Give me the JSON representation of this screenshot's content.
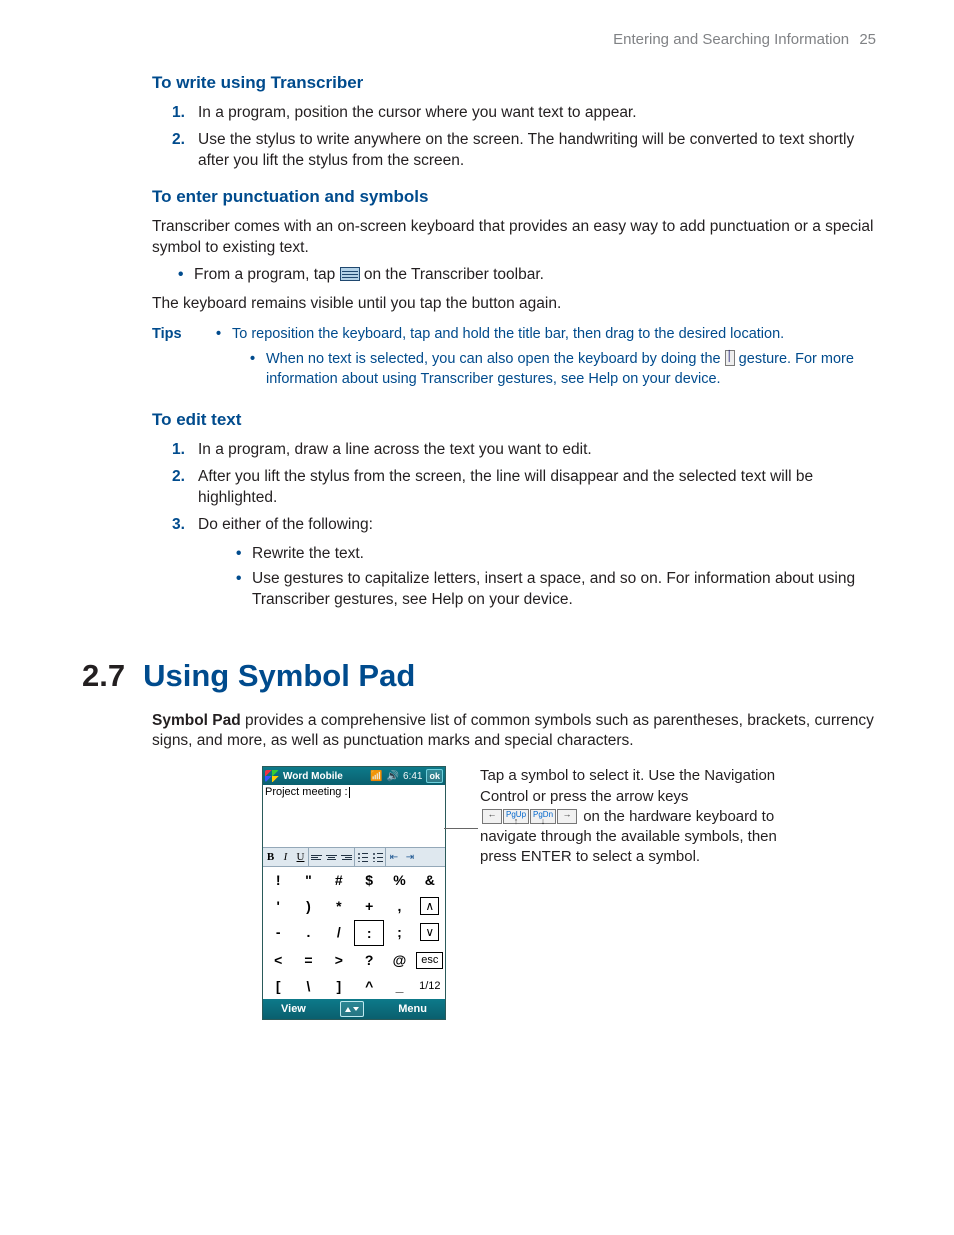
{
  "header": {
    "chapter_title": "Entering and Searching Information",
    "page_number": "25"
  },
  "s1": {
    "h": "To write using Transcriber",
    "steps": [
      "In a program, position the cursor where you want text to appear.",
      "Use the stylus to write anywhere on the screen. The handwriting will be converted to text shortly after you lift the stylus from the screen."
    ]
  },
  "s2": {
    "h": "To enter punctuation and symbols",
    "intro": "Transcriber comes with an on-screen keyboard that provides an easy way to add punctuation or a special symbol to existing text.",
    "bullet_pre": "From a program, tap ",
    "bullet_post": " on the Transcriber toolbar.",
    "after": "The keyboard remains visible until you tap the button again."
  },
  "tips": {
    "label": "Tips",
    "items": [
      "To reposition the keyboard, tap and hold the title bar, then drag to the desired location."
    ],
    "nested_pre": "When no text is selected, you can also open the keyboard by doing the ",
    "nested_post": " gesture. For more information about using Transcriber gestures, see Help on your device."
  },
  "s3": {
    "h": "To edit text",
    "steps": [
      "In a program, draw a line across the text you want to edit.",
      "After you lift the stylus from the screen, the line will disappear and the selected text will be highlighted.",
      "Do either of the following:"
    ],
    "sub": [
      "Rewrite the text.",
      "Use gestures to capitalize letters, insert a space, and so on. For information about using Transcriber gestures, see Help on your device."
    ]
  },
  "section": {
    "num": "2.7",
    "title": "Using Symbol Pad",
    "intro_bold": "Symbol Pad",
    "intro_rest": " provides a comprehensive list of common symbols such as parentheses, brackets, currency signs, and more, as well as punctuation marks and special characters."
  },
  "device": {
    "title": "Word Mobile",
    "time": "6:41",
    "ok": "ok",
    "doc_text": "Project meeting :",
    "toolbar_indent_left": "⇤",
    "toolbar_indent_right": "⇥",
    "symbols": [
      "!",
      "\"",
      "#",
      "$",
      "%",
      "&",
      "'",
      ")",
      "*",
      "+",
      ",",
      "_up_",
      "-",
      ".",
      "/",
      ":",
      ";",
      "_dn_",
      "<",
      "=",
      ">",
      "?",
      "@",
      "_esc_",
      "[",
      "\\",
      "]",
      "^",
      "_",
      "_pg_"
    ],
    "esc_label": "esc",
    "page_label": "1/12",
    "soft_left": "View",
    "soft_right": "Menu"
  },
  "callout": {
    "t1": "Tap a symbol to select it. Use the Navigation Control or press the arrow keys ",
    "t2": " on the hardware keyboard to navigate through the available symbols, then press ENTER to select a symbol.",
    "key_pgup": "PgUp",
    "key_pgdn": "PgDn"
  }
}
